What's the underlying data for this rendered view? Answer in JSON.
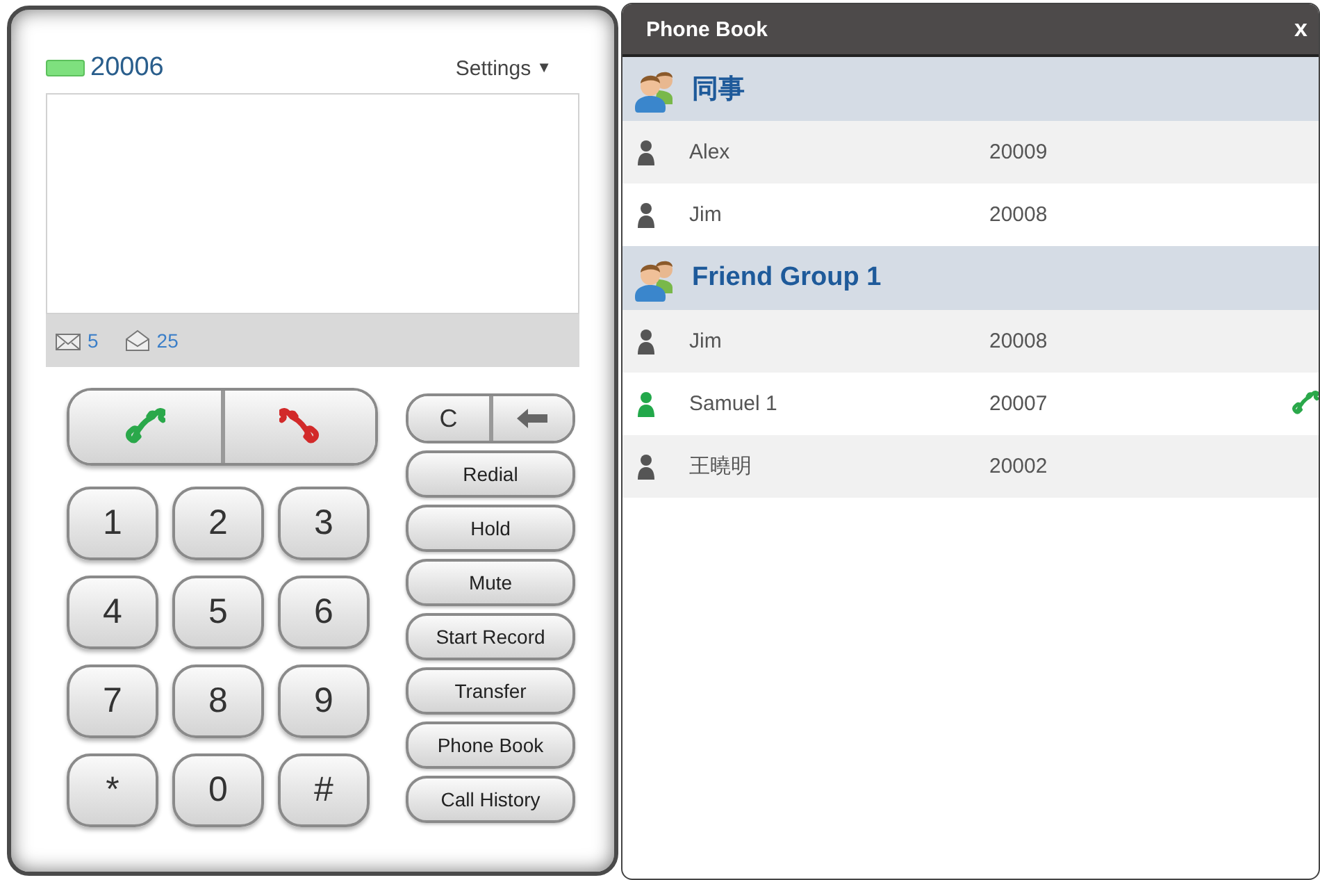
{
  "phone": {
    "registered": true,
    "extension": "20006",
    "settings": {
      "label": "Settings",
      "caret": "▼"
    },
    "messages": [
      {
        "kind": "closed",
        "count": "5"
      },
      {
        "kind": "open",
        "count": "25"
      }
    ],
    "call_buttons": [
      {
        "kind": "answer"
      },
      {
        "kind": "hangup"
      }
    ],
    "keypad": [
      "1",
      "2",
      "3",
      "4",
      "5",
      "6",
      "7",
      "8",
      "9",
      "*",
      "0",
      "#"
    ],
    "clear": {
      "label": "C"
    },
    "actions": [
      "Redial",
      "Hold",
      "Mute",
      "Start Record",
      "Transfer",
      "Phone Book",
      "Call History"
    ]
  },
  "phone_book": {
    "title": "Phone Book",
    "close": "x",
    "groups": [
      {
        "name": "同事",
        "contacts": [
          {
            "name": "Alex",
            "number": "20009",
            "online": false
          },
          {
            "name": "Jim",
            "number": "20008",
            "online": false
          }
        ]
      },
      {
        "name": "Friend Group 1",
        "contacts": [
          {
            "name": "Jim",
            "number": "20008",
            "online": false
          },
          {
            "name": "Samuel 1",
            "number": "20007",
            "online": true
          },
          {
            "name": "王曉明",
            "number": "20002",
            "online": false
          }
        ]
      }
    ]
  }
}
